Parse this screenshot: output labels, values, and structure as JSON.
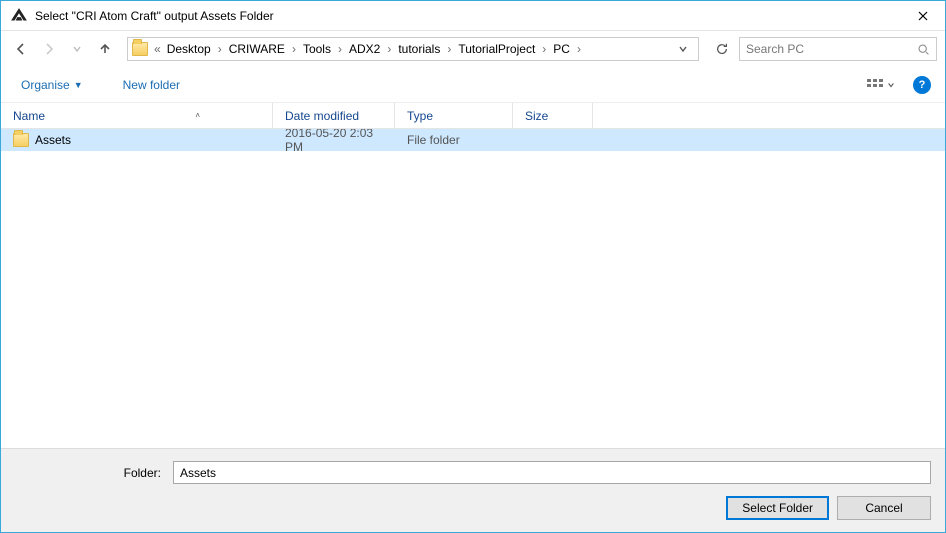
{
  "window": {
    "title": "Select \"CRI Atom Craft\" output Assets Folder"
  },
  "breadcrumb": {
    "prefix": "«",
    "items": [
      "Desktop",
      "CRIWARE",
      "Tools",
      "ADX2",
      "tutorials",
      "TutorialProject",
      "PC"
    ]
  },
  "search": {
    "placeholder": "Search PC"
  },
  "commands": {
    "organise": "Organise",
    "newfolder": "New folder"
  },
  "columns": {
    "name": "Name",
    "date": "Date modified",
    "type": "Type",
    "size": "Size"
  },
  "rows": [
    {
      "name": "Assets",
      "date": "2016-05-20 2:03 PM",
      "type": "File folder",
      "size": ""
    }
  ],
  "footer": {
    "folder_label": "Folder:",
    "folder_value": "Assets",
    "select_label": "Select Folder",
    "cancel_label": "Cancel"
  }
}
